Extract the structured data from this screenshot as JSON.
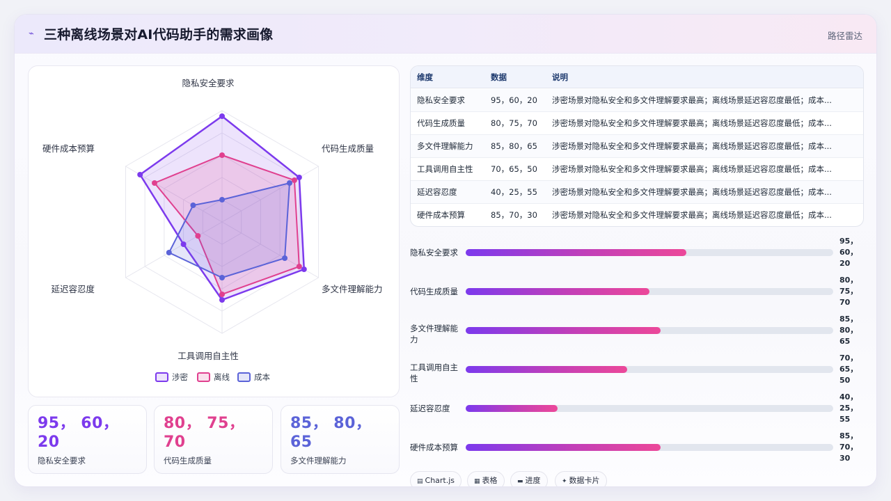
{
  "header": {
    "title": "三种离线场景对AI代码助手的需求画像",
    "subtitle": "路径雷达"
  },
  "table": {
    "headers": [
      "维度",
      "数据",
      "说明"
    ],
    "rows": [
      {
        "dim": "隐私安全要求",
        "data": "95，60，20",
        "note": "涉密场景对隐私安全和多文件理解要求最高；离线场景延迟容忍度最低；成本..."
      },
      {
        "dim": "代码生成质量",
        "data": "80，75，70",
        "note": "涉密场景对隐私安全和多文件理解要求最高；离线场景延迟容忍度最低；成本..."
      },
      {
        "dim": "多文件理解能力",
        "data": "85，80，65",
        "note": "涉密场景对隐私安全和多文件理解要求最高；离线场景延迟容忍度最低；成本..."
      },
      {
        "dim": "工具调用自主性",
        "data": "70，65，50",
        "note": "涉密场景对隐私安全和多文件理解要求最高；离线场景延迟容忍度最低；成本..."
      },
      {
        "dim": "延迟容忍度",
        "data": "40，25，55",
        "note": "涉密场景对隐私安全和多文件理解要求最高；离线场景延迟容忍度最低；成本..."
      },
      {
        "dim": "硬件成本预算",
        "data": "85，70，30",
        "note": "涉密场景对隐私安全和多文件理解要求最高；离线场景延迟容忍度最低；成本..."
      }
    ]
  },
  "bars": [
    {
      "name": "隐私安全要求",
      "value": 60,
      "label": "95，\n60，\n20"
    },
    {
      "name": "代码生成质量",
      "value": 50,
      "label": "80，\n75，\n70"
    },
    {
      "name": "多文件理解能\n力",
      "value": 53,
      "label": "85，\n80，\n65"
    },
    {
      "name": "工具调用自主\n性",
      "value": 44,
      "label": "70，\n65，\n50"
    },
    {
      "name": "延迟容忍度",
      "value": 25,
      "label": "40，\n25，\n55"
    },
    {
      "name": "硬件成本预算",
      "value": 53,
      "label": "85，\n70，\n30"
    }
  ],
  "stats": [
    {
      "value": "95， 60，\n20",
      "label": "隐私安全要求",
      "color": "#7c3aed"
    },
    {
      "value": "80， 75，\n70",
      "label": "代码生成质量",
      "color": "#e0408f"
    },
    {
      "value": "85， 80，\n65",
      "label": "多文件理解能力",
      "color": "#5b63d8"
    }
  ],
  "chips": [
    {
      "icon": "▤",
      "label": "Chart.js"
    },
    {
      "icon": "▦",
      "label": "表格"
    },
    {
      "icon": "▬",
      "label": "进度"
    },
    {
      "icon": "✦",
      "label": "数据卡片"
    }
  ],
  "chart_data": {
    "type": "radar",
    "axes": [
      "隐私安全要求",
      "代码生成质量",
      "多文件理解能力",
      "工具调用自主性",
      "延迟容忍度",
      "硬件成本预算"
    ],
    "rlim": [
      0,
      100
    ],
    "legend": "bottom",
    "series": [
      {
        "name": "涉密",
        "values": [
          95,
          80,
          85,
          70,
          40,
          85
        ],
        "color": "#7c3aed"
      },
      {
        "name": "离线",
        "values": [
          60,
          75,
          80,
          65,
          25,
          70
        ],
        "color": "#e0408f"
      },
      {
        "name": "成本",
        "values": [
          20,
          70,
          65,
          50,
          55,
          30
        ],
        "color": "#5b63d8"
      }
    ]
  }
}
